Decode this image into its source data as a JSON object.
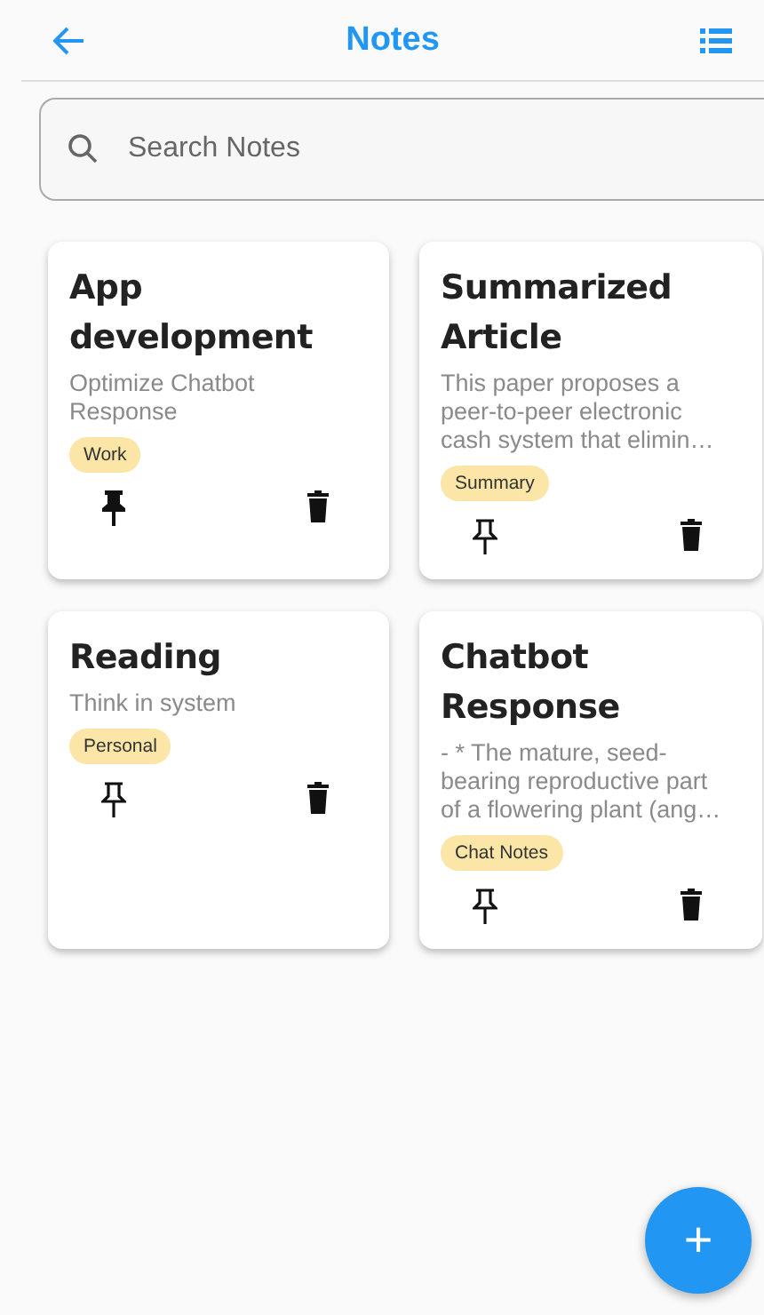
{
  "app_bar": {
    "title": "Notes"
  },
  "search": {
    "placeholder": "Search Notes"
  },
  "notes": [
    {
      "title": "App development",
      "body": "Optimize Chatbot Response",
      "tag": "Work",
      "pinned": true
    },
    {
      "title": "Summarized Article",
      "body": "This paper proposes a peer-to-peer electronic cash system that elimin…",
      "tag": "Summary",
      "pinned": false
    },
    {
      "title": "Reading",
      "body": "Think in system",
      "tag": "Personal",
      "pinned": false
    },
    {
      "title": "Chatbot Response",
      "body": "- * The mature, seed-bearing reproductive part of a flowering plant (ang…",
      "tag": "Chat Notes",
      "pinned": false
    }
  ],
  "fab": {
    "label": "+"
  }
}
